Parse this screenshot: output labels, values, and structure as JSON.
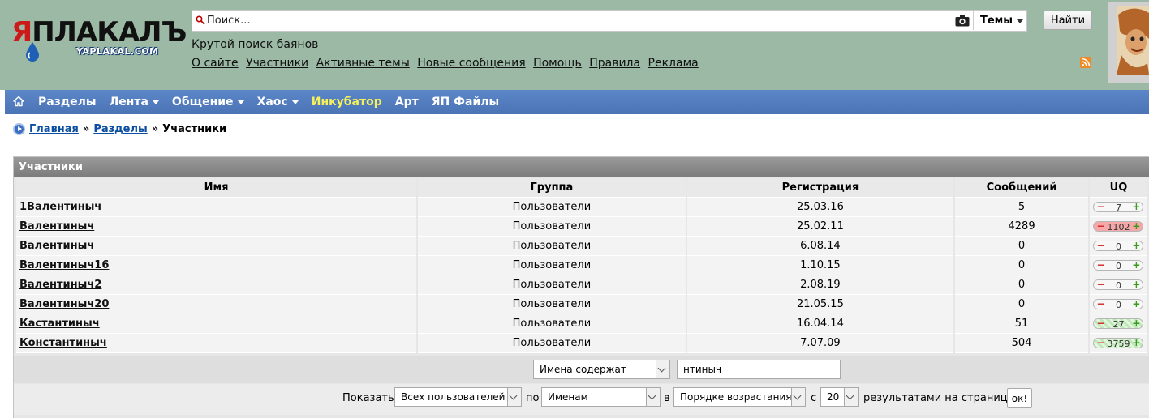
{
  "header": {
    "logo_text": "ЯПЛАКАЛЪ",
    "logo_ya": "Я",
    "logo_rest": "ПЛАКАЛЪ",
    "logo_sub": "YAPLAKAL.COM",
    "search": {
      "placeholder": "Поиск...",
      "value": "",
      "scope": "Темы"
    },
    "find_button": "Найти",
    "tagline": "Крутой поиск баянов",
    "links": [
      "О сайте",
      "Участники",
      "Активные темы",
      "Новые сообщения",
      "Помощь",
      "Правила",
      "Реклама"
    ]
  },
  "nav": {
    "items": [
      {
        "label": "Разделы",
        "dropdown": false,
        "highlight": false
      },
      {
        "label": "Лента",
        "dropdown": true,
        "highlight": false
      },
      {
        "label": "Общение",
        "dropdown": true,
        "highlight": false
      },
      {
        "label": "Хаос",
        "dropdown": true,
        "highlight": false
      },
      {
        "label": "Инкубатор",
        "dropdown": false,
        "highlight": true
      },
      {
        "label": "Арт",
        "dropdown": false,
        "highlight": false
      },
      {
        "label": "ЯП Файлы",
        "dropdown": false,
        "highlight": false
      }
    ]
  },
  "breadcrumb": {
    "home": "Главная",
    "sections": "Разделы",
    "current": "Участники",
    "separator": "»"
  },
  "panel": {
    "title": "Участники",
    "columns": [
      "Имя",
      "Группа",
      "Регистрация",
      "Сообщений",
      "UQ"
    ],
    "rows": [
      {
        "name": "1Валентиныч",
        "group": "Пользователи",
        "registered": "25.03.16",
        "posts": "5",
        "uq": "7",
        "uq_style": "neutral"
      },
      {
        "name": "Валентиныч",
        "group": "Пользователи",
        "registered": "25.02.11",
        "posts": "4289",
        "uq": "1102",
        "uq_style": "neg"
      },
      {
        "name": "Валентиныч",
        "group": "Пользователи",
        "registered": "6.08.14",
        "posts": "0",
        "uq": "0",
        "uq_style": "neutral"
      },
      {
        "name": "Валентиныч16",
        "group": "Пользователи",
        "registered": "1.10.15",
        "posts": "0",
        "uq": "0",
        "uq_style": "neutral"
      },
      {
        "name": "Валентиныч2",
        "group": "Пользователи",
        "registered": "2.08.19",
        "posts": "0",
        "uq": "0",
        "uq_style": "neutral"
      },
      {
        "name": "Валентиныч20",
        "group": "Пользователи",
        "registered": "21.05.15",
        "posts": "0",
        "uq": "0",
        "uq_style": "neutral"
      },
      {
        "name": "Кастантиныч",
        "group": "Пользователи",
        "registered": "16.04.14",
        "posts": "51",
        "uq": "27",
        "uq_style": "pos"
      },
      {
        "name": "Константиныч",
        "group": "Пользователи",
        "registered": "7.07.09",
        "posts": "504",
        "uq": "3759",
        "uq_style": "pos"
      }
    ],
    "filter": {
      "mode": "Имена содержат",
      "query": "нтиныч"
    },
    "options": {
      "show_label": "Показать",
      "show_value": "Всех пользователей",
      "by_label": "по",
      "by_value": "Именам",
      "in_label": "в",
      "order_value": "Порядке возрастания",
      "from_label": "с",
      "count_value": "20",
      "per_page_label": "результатами на страницу",
      "ok_button": "ок!"
    }
  },
  "colors": {
    "header_bg": "#9bb9a4",
    "nav_bg": "#5b86c8",
    "nav_highlight": "#f6f15b",
    "link": "#0a4ea2",
    "panel_title_bg": "#8a8a8a"
  }
}
